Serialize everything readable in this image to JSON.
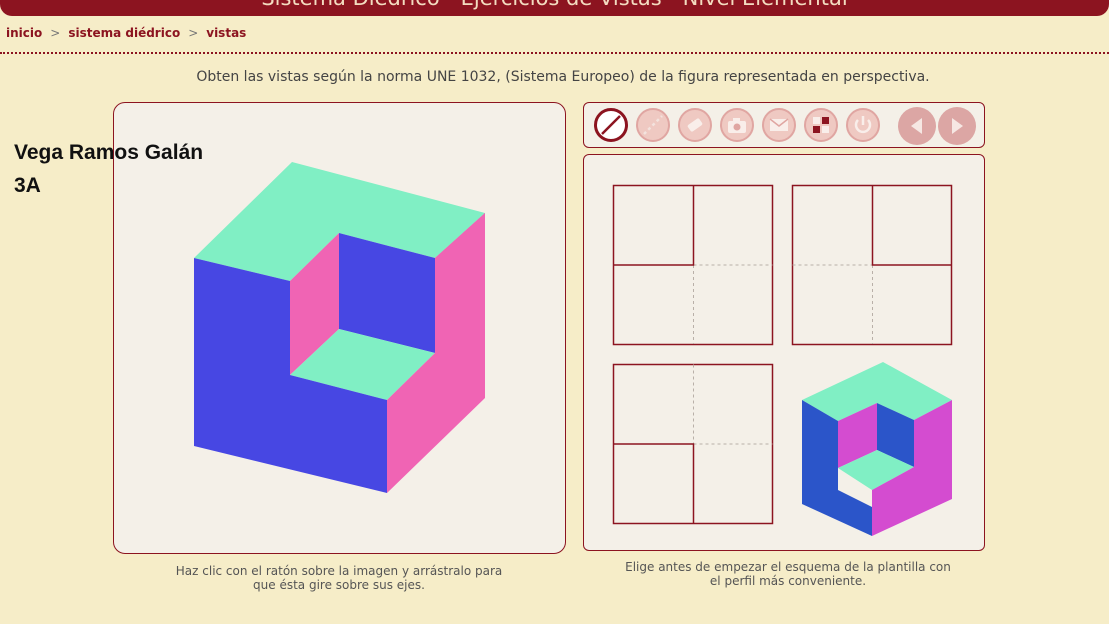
{
  "header": {
    "title": "Sistema Diédrico - Ejercicios de Vistas - Nivel Elemental"
  },
  "breadcrumb": {
    "items": [
      "inicio",
      "sistema diédrico",
      "vistas"
    ],
    "separator": ">"
  },
  "instruction": "Obten las vistas según la norma UNE 1032, (Sistema Europeo) de la figura representada en perspectiva.",
  "student": {
    "name": "Vega Ramos Galán",
    "group": "3A"
  },
  "toolbar": {
    "tools": [
      "line-tool",
      "dashed-line-tool",
      "eraser-tool",
      "camera-tool",
      "email-tool",
      "layout-tool",
      "power-tool",
      "previous",
      "next"
    ],
    "active": "line-tool"
  },
  "captions": {
    "left": [
      "Haz clic con el ratón sobre la imagen y arrástralo para",
      "que ésta gire sobre sus ejes."
    ],
    "right": [
      "Elige antes de empezar el esquema de la plantilla con",
      "el perfil más conveniente."
    ]
  },
  "colors": {
    "brand": "#8c1420",
    "background": "#f6edc8",
    "face_top": "#80efc4",
    "face_front": "#4747e3",
    "face_side": "#f064b4",
    "thumb_front": "#2b55c9",
    "thumb_side": "#d44cd0"
  }
}
